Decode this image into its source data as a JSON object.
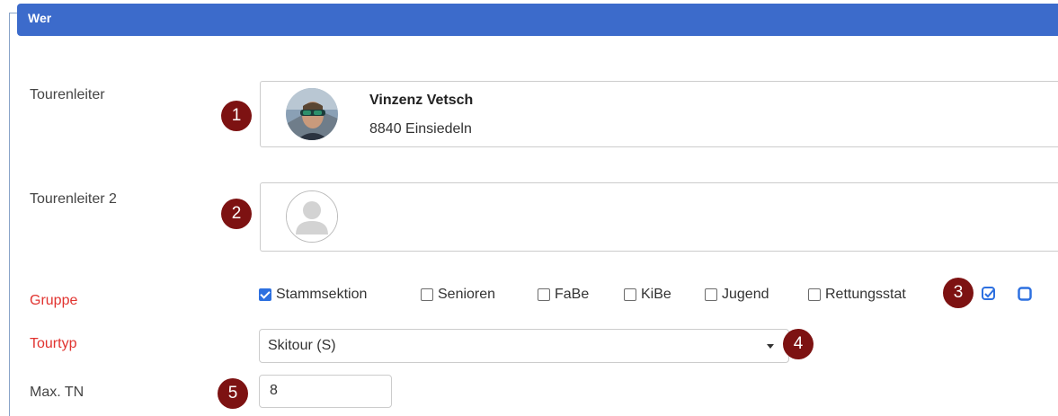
{
  "panel": {
    "title": "Wer"
  },
  "fields": {
    "tourenleiter": {
      "label": "Tourenleiter",
      "name": "Vinzenz Vetsch",
      "city": "8840 Einsiedeln"
    },
    "tourenleiter2": {
      "label": "Tourenleiter 2"
    },
    "gruppe": {
      "label": "Gruppe",
      "options": [
        {
          "label": "Stammsektion",
          "checked": true
        },
        {
          "label": "Senioren",
          "checked": false
        },
        {
          "label": "FaBe",
          "checked": false
        },
        {
          "label": "KiBe",
          "checked": false
        },
        {
          "label": "Jugend",
          "checked": false
        },
        {
          "label": "Rettungsstat",
          "checked": false
        }
      ],
      "tools": [
        "check-all-icon",
        "uncheck-all-icon"
      ]
    },
    "tourtyp": {
      "label": "Tourtyp",
      "value": "Skitour (S)"
    },
    "max_tn": {
      "label": "Max. TN",
      "value": "8"
    }
  },
  "markers": [
    "1",
    "2",
    "3",
    "4",
    "5"
  ],
  "colors": {
    "header": "#3c6bcb",
    "required": "#e1332f",
    "marker": "#7d1212",
    "checkbox": "#2d70e0"
  }
}
